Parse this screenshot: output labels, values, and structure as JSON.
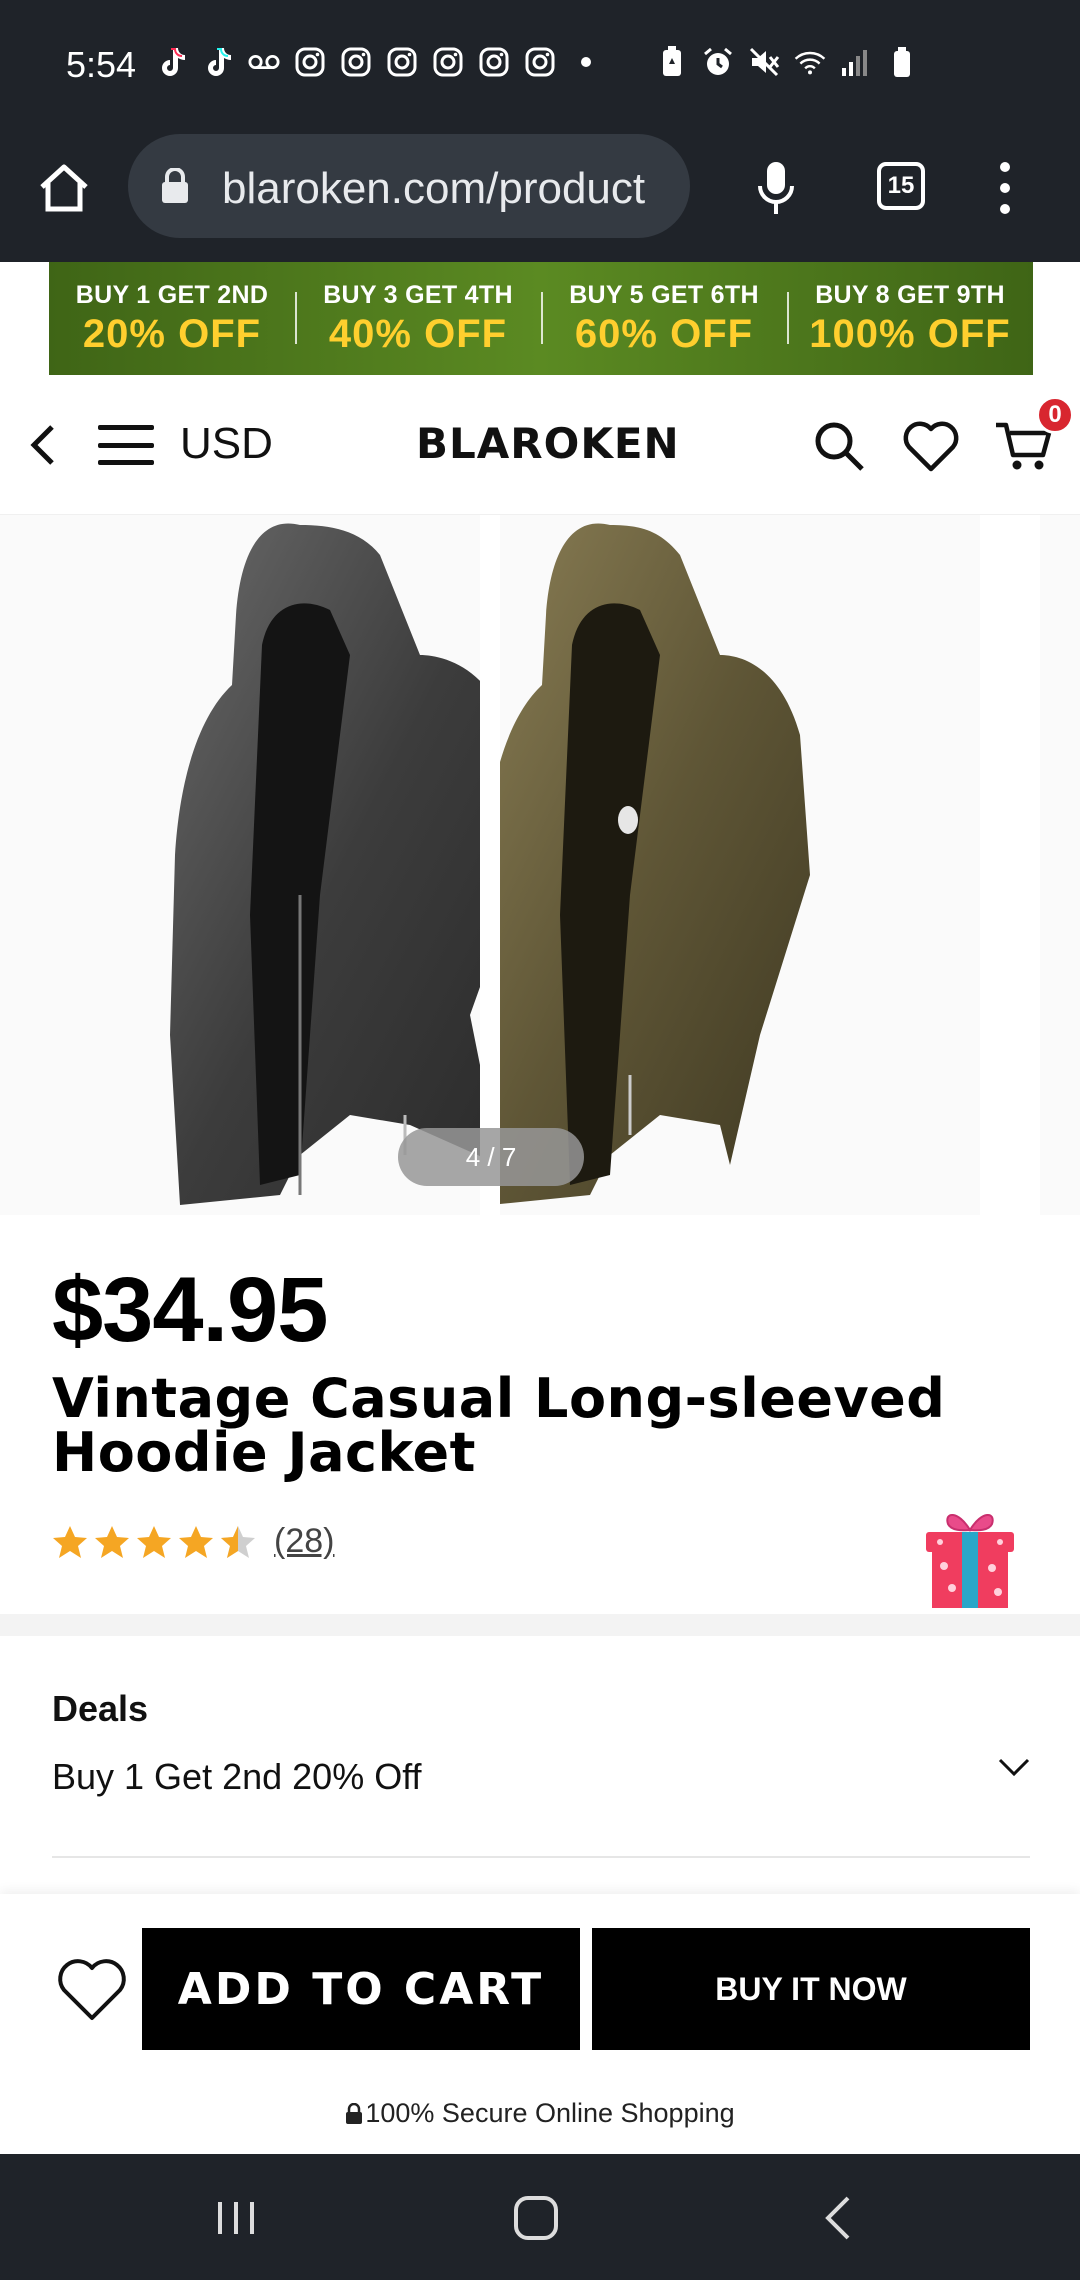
{
  "status_bar": {
    "time": "5:54",
    "left_icons": [
      "tiktok-icon",
      "tiktok-icon",
      "voicemail-icon",
      "instagram-icon",
      "instagram-icon",
      "instagram-icon",
      "instagram-icon",
      "instagram-icon",
      "instagram-icon",
      "dot-icon"
    ],
    "right_icons": [
      "battery-saver-icon",
      "alarm-icon",
      "mute-icon",
      "wifi-icon",
      "signal-icon",
      "battery-icon"
    ]
  },
  "browser": {
    "url": "blaroken.com/product",
    "tab_count": "15"
  },
  "promo": [
    {
      "top": "BUY 1 GET 2ND",
      "bottom": "20% OFF"
    },
    {
      "top": "BUY 3 GET 4TH",
      "bottom": "40% OFF"
    },
    {
      "top": "BUY 5 GET 6TH",
      "bottom": "60% OFF"
    },
    {
      "top": "BUY 8 GET 9TH",
      "bottom": "100% OFF"
    }
  ],
  "header": {
    "currency": "USD",
    "logo": "BLAROKEN",
    "cart_count": "0"
  },
  "gallery": {
    "pager": "4 / 7"
  },
  "product": {
    "price": "$34.95",
    "title": "Vintage Casual Long-sleeved Hoodie Jacket",
    "rating": 4.5,
    "review_count": "(28)"
  },
  "deals": {
    "label": "Deals",
    "value": "Buy 1 Get 2nd 20% Off"
  },
  "actions": {
    "add_to_cart": "ADD TO CART",
    "buy_now": "BUY IT NOW",
    "secure_text": "100% Secure Online Shopping"
  },
  "colors": {
    "status_bg": "#1f2329",
    "promo_green": "#5b8a22",
    "promo_yellow": "#ffcf2e",
    "star": "#f5a623",
    "badge_red": "#d8262f",
    "button_black": "#000000"
  }
}
